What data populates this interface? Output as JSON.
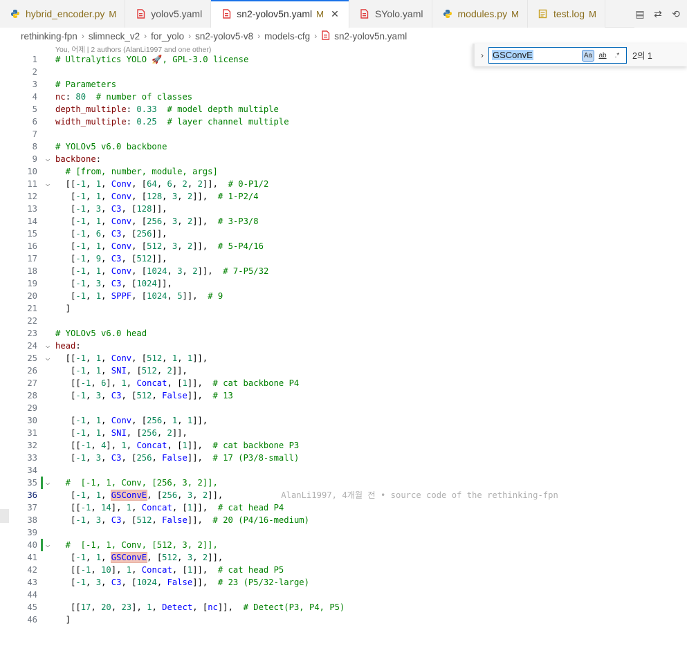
{
  "tabs": [
    {
      "label": "hybrid_encoder.py",
      "icon": "python-icon",
      "status": "M",
      "state": "modified"
    },
    {
      "label": "yolov5.yaml",
      "icon": "yaml-icon",
      "status": "",
      "state": "untracked"
    },
    {
      "label": "sn2-yolov5n.yaml",
      "icon": "yaml-icon",
      "status": "M",
      "state": "active",
      "close": "✕"
    },
    {
      "label": "SYolo.yaml",
      "icon": "yaml-icon",
      "status": "",
      "state": "untracked"
    },
    {
      "label": "modules.py",
      "icon": "python-icon",
      "status": "M",
      "state": "modified"
    },
    {
      "label": "test.log",
      "icon": "log-icon",
      "status": "M",
      "state": "modified"
    }
  ],
  "breadcrumb": [
    "rethinking-fpn",
    "slimneck_v2",
    "for_yolo",
    "sn2-yolov5-v8",
    "models-cfg",
    "sn2-yolov5n.yaml"
  ],
  "codelens": "You, 어제 | 2 authors (AlanLi1997 and one other)",
  "find": {
    "query": "GSConvE",
    "match_case": "Aa",
    "whole_word": "ab",
    "regex": ".*",
    "count": "2의 1"
  },
  "blame": "AlanLi1997, 4개월 전 • source code of the rethinking-fpn",
  "colors": {
    "accent": "#1a73e8",
    "git_added": "#2ea043",
    "match_highlight": "#f2c4b8"
  },
  "lines": [
    "# Ultralytics YOLO 🚀, GPL-3.0 license",
    "",
    "# Parameters",
    "nc: 80  # number of classes",
    "depth_multiple: 0.33  # model depth multiple",
    "width_multiple: 0.25  # layer channel multiple",
    "",
    "# YOLOv5 v6.0 backbone",
    "backbone:",
    "  # [from, number, module, args]",
    "  [[-1, 1, Conv, [64, 6, 2, 2]],  # 0-P1/2",
    "   [-1, 1, Conv, [128, 3, 2]],  # 1-P2/4",
    "   [-1, 3, C3, [128]],",
    "   [-1, 1, Conv, [256, 3, 2]],  # 3-P3/8",
    "   [-1, 6, C3, [256]],",
    "   [-1, 1, Conv, [512, 3, 2]],  # 5-P4/16",
    "   [-1, 9, C3, [512]],",
    "   [-1, 1, Conv, [1024, 3, 2]],  # 7-P5/32",
    "   [-1, 3, C3, [1024]],",
    "   [-1, 1, SPPF, [1024, 5]],  # 9",
    "  ]",
    "",
    "# YOLOv5 v6.0 head",
    "head:",
    "  [[-1, 1, Conv, [512, 1, 1]],",
    "   [-1, 1, SNI, [512, 2]],",
    "   [[-1, 6], 1, Concat, [1]],  # cat backbone P4",
    "   [-1, 3, C3, [512, False]],  # 13",
    "",
    "   [-1, 1, Conv, [256, 1, 1]],",
    "   [-1, 1, SNI, [256, 2]],",
    "   [[-1, 4], 1, Concat, [1]],  # cat backbone P3",
    "   [-1, 3, C3, [256, False]],  # 17 (P3/8-small)",
    "",
    "  #  [-1, 1, Conv, [256, 3, 2]],",
    "   [-1, 1, GSConvE, [256, 3, 2]],",
    "   [[-1, 14], 1, Concat, [1]],  # cat head P4",
    "   [-1, 3, C3, [512, False]],  # 20 (P4/16-medium)",
    "",
    "  #  [-1, 1, Conv, [512, 3, 2]],",
    "   [-1, 1, GSConvE, [512, 3, 2]],",
    "   [[-1, 10], 1, Concat, [1]],  # cat head P5",
    "   [-1, 3, C3, [1024, False]],  # 23 (P5/32-large)",
    "",
    "   [[17, 20, 23], 1, Detect, [nc]],  # Detect(P3, P4, P5)",
    "  ]"
  ]
}
